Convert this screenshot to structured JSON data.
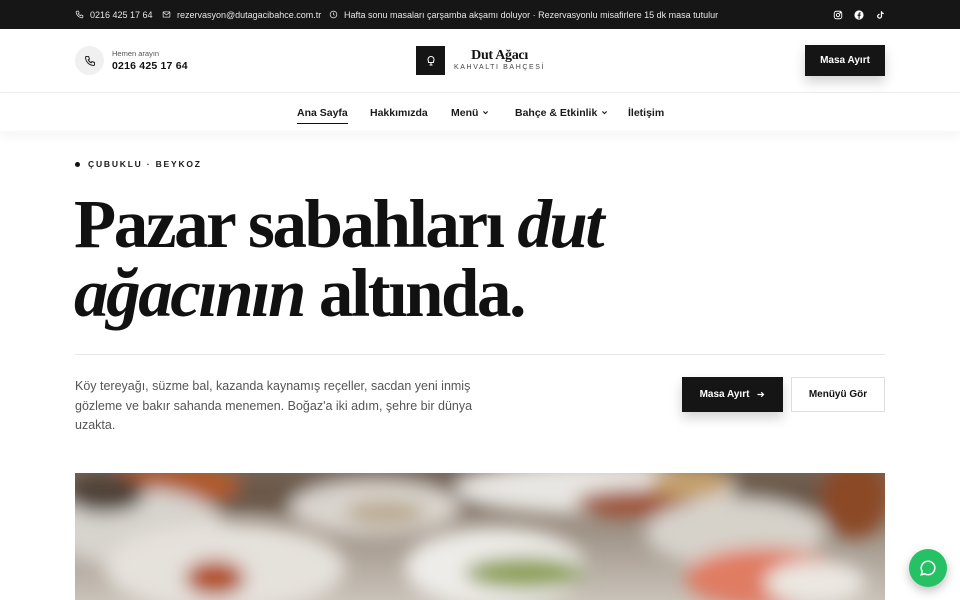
{
  "topbar": {
    "phone": "0216 425 17 64",
    "email": "rezervasyon@dutagacibahce.com.tr",
    "notice": "Hafta sonu masaları çarşamba akşamı doluyor · Rezervasyonlu misafirlere 15 dk masa tutulur",
    "social_icons": [
      "instagram-icon",
      "facebook-icon",
      "tiktok-icon"
    ]
  },
  "header": {
    "call_label": "Hemen arayın",
    "call_number": "0216 425 17 64",
    "brand_name": "Dut Ağacı",
    "brand_tagline": "KAHVALTI BAHÇESİ",
    "cta_label": "Masa Ayırt"
  },
  "nav": {
    "items": [
      {
        "label": "Ana Sayfa",
        "active": true,
        "dropdown": false
      },
      {
        "label": "Hakkımızda",
        "active": false,
        "dropdown": false
      },
      {
        "label": "Menü",
        "active": false,
        "dropdown": true
      },
      {
        "label": "Bahçe & Etkinlik",
        "active": false,
        "dropdown": true
      },
      {
        "label": "İletişim",
        "active": false,
        "dropdown": false
      }
    ]
  },
  "hero": {
    "eyebrow": "ÇUBUKLU · BEYKOZ",
    "headline_1a": "Pazar sabahları ",
    "headline_1b": "dut",
    "headline_2a": "ağacının",
    "headline_2b": " altında.",
    "lead": "Köy tereyağı, süzme bal, kazanda kaynamış reçeller, sacdan yeni inmiş gözleme ve bakır sahanda menemen. Boğaz'a iki adım, şehre bir dünya uzakta.",
    "primary_cta": "Masa Ayırt",
    "secondary_cta": "Menüyü Gör"
  },
  "colors": {
    "dark": "#151515",
    "whatsapp": "#25c164",
    "text_muted": "#555555"
  }
}
